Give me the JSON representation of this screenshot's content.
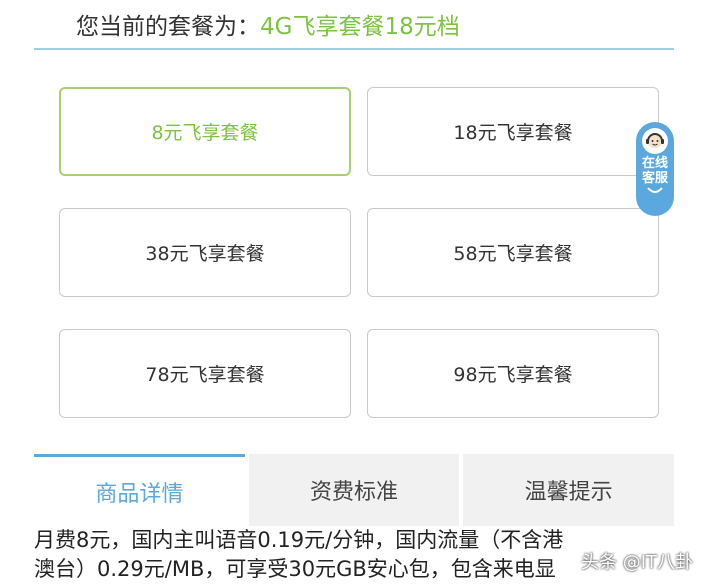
{
  "header": {
    "label": "您当前的套餐为：",
    "current_plan": "4G飞享套餐18元档"
  },
  "plans": [
    {
      "label": "8元飞享套餐",
      "selected": true
    },
    {
      "label": "18元飞享套餐",
      "selected": false
    },
    {
      "label": "38元飞享套餐",
      "selected": false
    },
    {
      "label": "58元飞享套餐",
      "selected": false
    },
    {
      "label": "78元飞享套餐",
      "selected": false
    },
    {
      "label": "98元飞享套餐",
      "selected": false
    }
  ],
  "online_service": {
    "text": "在线客服",
    "icon": "customer-service-avatar-icon"
  },
  "tabs": [
    {
      "label": "商品详情",
      "active": true
    },
    {
      "label": "资费标准",
      "active": false
    },
    {
      "label": "温馨提示",
      "active": false
    }
  ],
  "description": {
    "line1": "月费8元，国内主叫语音0.19元/分钟，国内流量（不含港",
    "line2": "澳台）0.29元/MB，可享受30元GB安心包，包含来电显"
  },
  "watermark": "头条 @IT八卦",
  "colors": {
    "accent_green": "#7dc242",
    "accent_blue": "#5aa8dd",
    "border_gray": "#c9c9c9"
  }
}
